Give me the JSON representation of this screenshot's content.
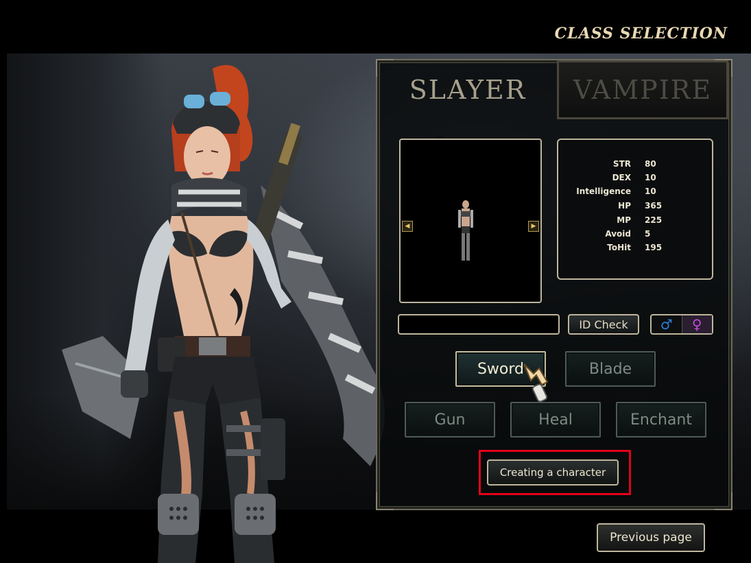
{
  "header": {
    "title": "CLASS SELECTION"
  },
  "tabs": [
    {
      "label": "SLAYER",
      "selected": true
    },
    {
      "label": "VAMPIRE",
      "selected": false
    }
  ],
  "preview": {
    "prev_icon": "arrow-left-icon",
    "next_icon": "arrow-right-icon"
  },
  "stats": [
    {
      "label": "STR",
      "value": "80"
    },
    {
      "label": "DEX",
      "value": "10"
    },
    {
      "label": "Intelligence",
      "value": "10"
    },
    {
      "label": "HP",
      "value": "365"
    },
    {
      "label": "MP",
      "value": "225"
    },
    {
      "label": "Avoid",
      "value": "5"
    },
    {
      "label": "ToHit",
      "value": "195"
    }
  ],
  "name_field": {
    "value": ""
  },
  "id_check_label": "ID Check",
  "gender": {
    "male_icon": "male-symbol-icon",
    "female_icon": "female-symbol-icon",
    "male_glyph": "♂",
    "female_glyph": "♀"
  },
  "skills": [
    {
      "label": "Sword",
      "selected": true
    },
    {
      "label": "Blade",
      "selected": false
    },
    {
      "label": "Gun",
      "selected": false
    },
    {
      "label": "Heal",
      "selected": false
    },
    {
      "label": "Enchant",
      "selected": false
    }
  ],
  "create_label": "Creating a character",
  "previous_label": "Previous page",
  "colors": {
    "highlight": "#e3001b",
    "title": "#e9d9b3",
    "male": "#2e7fd8",
    "female": "#c24bd9"
  }
}
